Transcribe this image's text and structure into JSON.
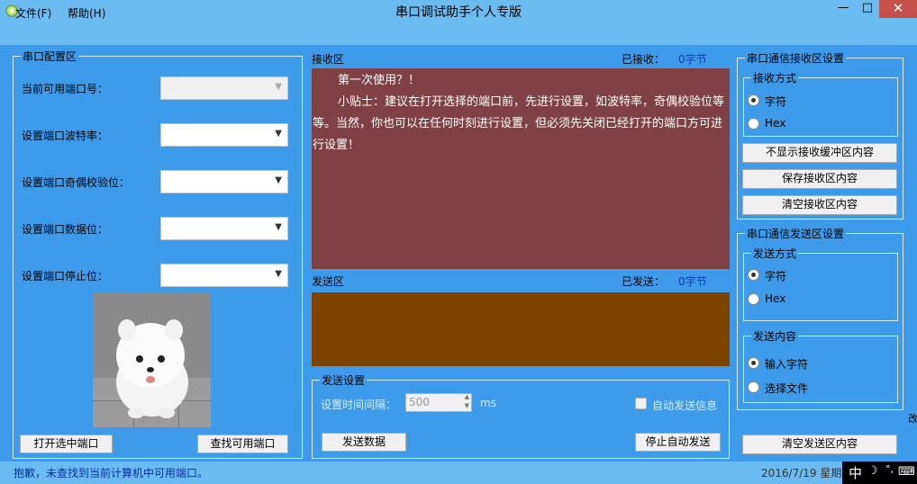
{
  "window": {
    "title": "串口调试助手个人专版",
    "min_label": "—",
    "max_label": "□",
    "close_label": "✕"
  },
  "menu": {
    "file": "文件(F)",
    "help": "帮助(H)"
  },
  "port_config": {
    "legend": "串口配置区",
    "available_port_label": "当前可用端口号：",
    "baud_label": "设置端口波特率：",
    "parity_label": "设置端口奇偶校验位：",
    "databits_label": "设置端口数据位：",
    "stopbits_label": "设置端口停止位：",
    "open_button": "打开选中端口",
    "find_button": "查找可用端口"
  },
  "receive": {
    "title": "接收区",
    "count_label": "已接收：",
    "count_value": "0字节",
    "line1": "第一次使用？！",
    "line2": "小贴士：建议在打开选择的端口前，先进行设置，如波特率，奇偶校验位等等。当然，你也可以在任何时刻进行设置，但必须先关闭已经打开的端口方可进行设置！"
  },
  "send": {
    "title": "发送区",
    "count_label": "已发送：",
    "count_value": "0字节"
  },
  "send_settings": {
    "legend": "发送设置",
    "interval_label": "设置时间间隔：",
    "interval_value": "500",
    "interval_unit": "ms",
    "auto_send_label": "自动发送信息",
    "send_button": "发送数据",
    "stop_button": "停止自动发送"
  },
  "recv_settings": {
    "legend": "串口通信接收区设置",
    "mode_legend": "接收方式",
    "mode_char": "字符",
    "mode_hex": "Hex",
    "hide_buffer_button": "不显示接收缓冲区内容",
    "save_button": "保存接收区内容",
    "clear_button": "清空接收区内容"
  },
  "send_area_settings": {
    "legend": "串口通信发送区设置",
    "mode_legend": "发送方式",
    "mode_char": "字符",
    "mode_hex": "Hex",
    "content_legend": "发送内容",
    "content_input": "输入字符",
    "content_file": "选择文件",
    "clear_button": "清空发送区内容"
  },
  "edge_char": "改",
  "status": {
    "message": "抱歉，未查找到当前计算机中可用端口。",
    "date": "2016/7/19 星期",
    "ime_mode": "中",
    "ime_moon": "☽",
    "ime_punct": "°,",
    "ime_keyboard": "⌨"
  }
}
